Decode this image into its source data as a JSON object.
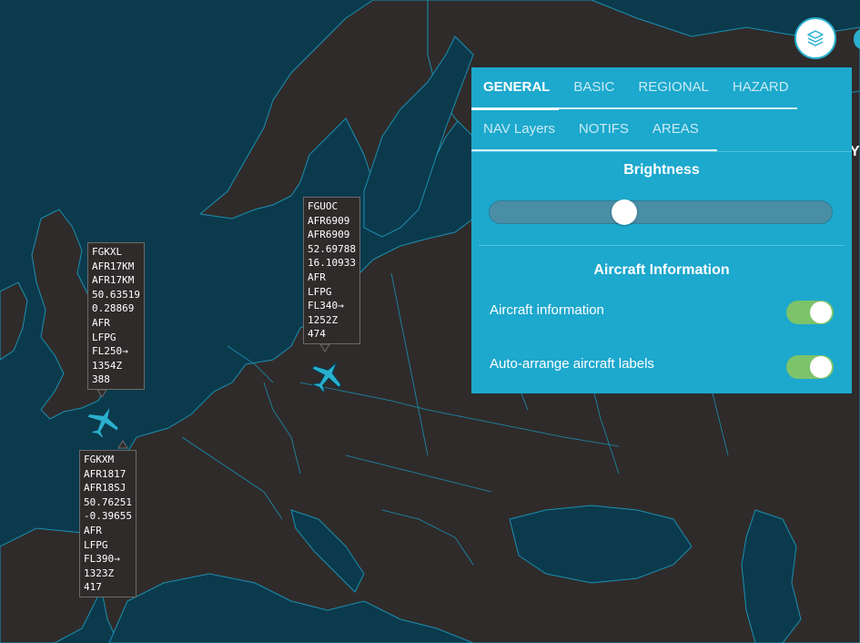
{
  "map": {
    "sea_color": "#0b3a4c",
    "land_color": "#2f2b2b",
    "border_color": "#1a8fb0",
    "aircraft_color": "#2ab0cf"
  },
  "flights": [
    {
      "lines": [
        "FGKXL",
        "AFR17KM",
        "AFR17KM",
        "50.63519",
        "0.28869",
        "AFR",
        "LFPG",
        "FL250→",
        "1354Z",
        "388"
      ]
    },
    {
      "lines": [
        "FGUOC",
        "AFR6909",
        "AFR6909",
        "52.69788",
        "16.10933",
        "AFR",
        "LFPG",
        "FL340→",
        "1252Z",
        "474"
      ]
    },
    {
      "lines": [
        "FGKXM",
        "AFR1817",
        "AFR18SJ",
        "50.76251",
        "-0.39655",
        "AFR",
        "LFPG",
        "FL390→",
        "1323Z",
        "417"
      ]
    }
  ],
  "layers_button": {
    "icon": "layers-icon"
  },
  "panel": {
    "tabs_row1": [
      "GENERAL",
      "BASIC",
      "REGIONAL",
      "HAZARD"
    ],
    "tabs_row2": [
      "NAV Layers",
      "NOTIFS",
      "AREAS"
    ],
    "active_tab": "GENERAL",
    "brightness": {
      "title": "Brightness",
      "value_fraction": 0.385
    },
    "aircraft_info": {
      "title": "Aircraft Information",
      "toggles": [
        {
          "label": "Aircraft information",
          "on": true
        },
        {
          "label": "Auto-arrange aircraft labels",
          "on": true
        }
      ]
    }
  },
  "edge_text": "Y"
}
